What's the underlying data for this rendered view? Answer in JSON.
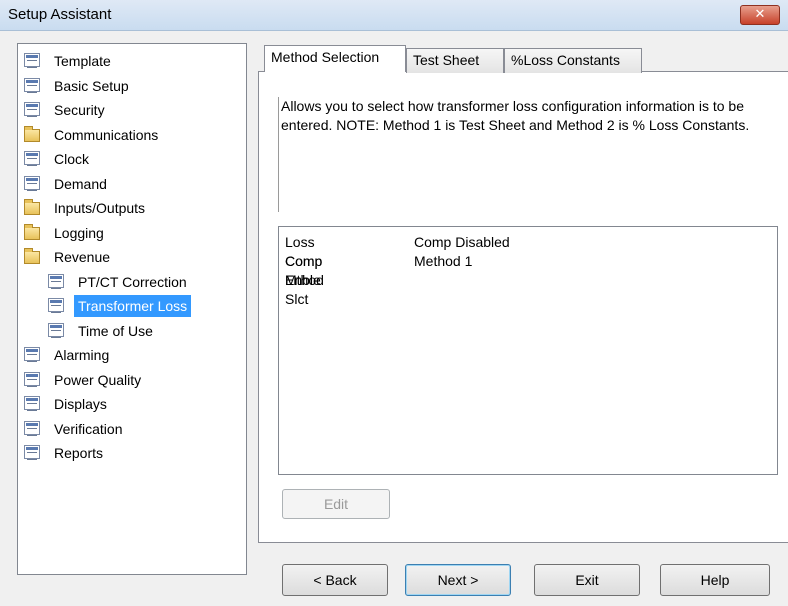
{
  "window": {
    "title": "Setup Assistant",
    "close_glyph": "✕"
  },
  "tree": {
    "items": [
      {
        "label": "Template",
        "icon": "page-icon",
        "indent": 0
      },
      {
        "label": "Basic Setup",
        "icon": "page-icon",
        "indent": 0
      },
      {
        "label": "Security",
        "icon": "page-icon",
        "indent": 0
      },
      {
        "label": "Communications",
        "icon": "folder-icon",
        "indent": 0
      },
      {
        "label": "Clock",
        "icon": "page-icon",
        "indent": 0
      },
      {
        "label": "Demand",
        "icon": "page-icon",
        "indent": 0
      },
      {
        "label": "Inputs/Outputs",
        "icon": "folder-icon",
        "indent": 0
      },
      {
        "label": "Logging",
        "icon": "folder-icon",
        "indent": 0
      },
      {
        "label": "Revenue",
        "icon": "folder-icon",
        "indent": 0
      },
      {
        "label": "PT/CT Correction",
        "icon": "page-icon",
        "indent": 1
      },
      {
        "label": "Transformer Loss",
        "icon": "page-icon",
        "indent": 1,
        "selected": true
      },
      {
        "label": "Time of Use",
        "icon": "page-icon",
        "indent": 1
      },
      {
        "label": "Alarming",
        "icon": "page-icon",
        "indent": 0
      },
      {
        "label": "Power Quality",
        "icon": "page-icon",
        "indent": 0
      },
      {
        "label": "Displays",
        "icon": "page-icon",
        "indent": 0
      },
      {
        "label": "Verification",
        "icon": "page-icon",
        "indent": 0
      },
      {
        "label": "Reports",
        "icon": "page-icon",
        "indent": 0
      }
    ]
  },
  "tabs": [
    {
      "label": "Method Selection",
      "active": true
    },
    {
      "label": "Test Sheet"
    },
    {
      "label": "%Loss Constants"
    }
  ],
  "description": "Allows you to select how transformer loss configuration information is to be entered. NOTE: Method 1 is Test Sheet and Method 2 is % Loss Constants.",
  "settings": [
    {
      "name": "Loss Comp Enble",
      "value": "Comp Disabled"
    },
    {
      "name": "Comp Mthod Slct",
      "value": "Method 1"
    }
  ],
  "edit_label": "Edit",
  "buttons": {
    "back": "< Back",
    "next": "Next >",
    "exit": "Exit",
    "help": "Help"
  },
  "colors": {
    "selection": "#3399ff",
    "close_button": "#c7412a"
  }
}
